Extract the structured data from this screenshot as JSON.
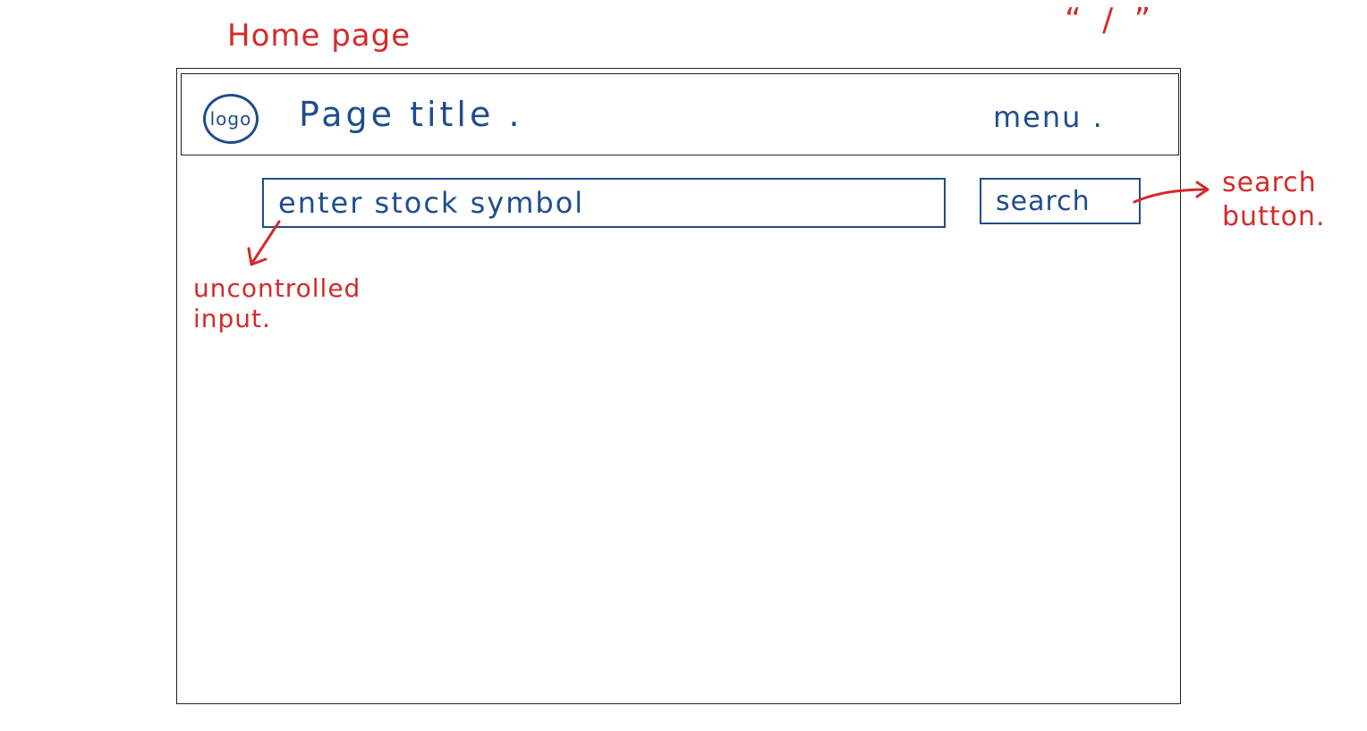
{
  "annotations": {
    "page_name": "Home page",
    "route": "“ / ”",
    "input_note": "uncontrolled\ninput.",
    "button_note": "search\nbutton."
  },
  "wireframe": {
    "logo_label": "logo",
    "page_title": "Page title .",
    "menu_label": "menu .",
    "search_placeholder": "enter stock symbol",
    "search_button_label": "search"
  },
  "colors": {
    "annotation": "#d42a2a",
    "wireframe_ink": "#1f4d8c",
    "frame": "#222222"
  }
}
